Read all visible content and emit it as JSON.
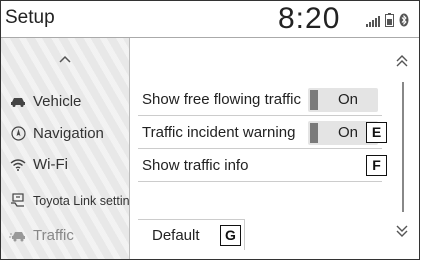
{
  "header": {
    "title": "Setup",
    "clock": "8:20"
  },
  "status": {
    "signal_icon": "signal-bars-icon",
    "battery_icon": "battery-icon",
    "bluetooth_icon": "bluetooth-icon"
  },
  "sidebar": {
    "items": [
      {
        "label": "Vehicle",
        "icon": "car-icon"
      },
      {
        "label": "Navigation",
        "icon": "compass-icon"
      },
      {
        "label": "Wi-Fi",
        "icon": "wifi-icon"
      },
      {
        "label": "Toyota Link settings",
        "icon": "toyota-link-icon"
      },
      {
        "label": "Traffic",
        "icon": "traffic-car-icon",
        "active": true
      }
    ]
  },
  "settings": {
    "rows": [
      {
        "label": "Show free flowing traffic",
        "toggle": "On"
      },
      {
        "label": "Traffic incident warning",
        "toggle": "On",
        "callout": "E"
      },
      {
        "label": "Show traffic info",
        "callout": "F"
      }
    ],
    "default_label": "Default",
    "default_callout": "G"
  }
}
